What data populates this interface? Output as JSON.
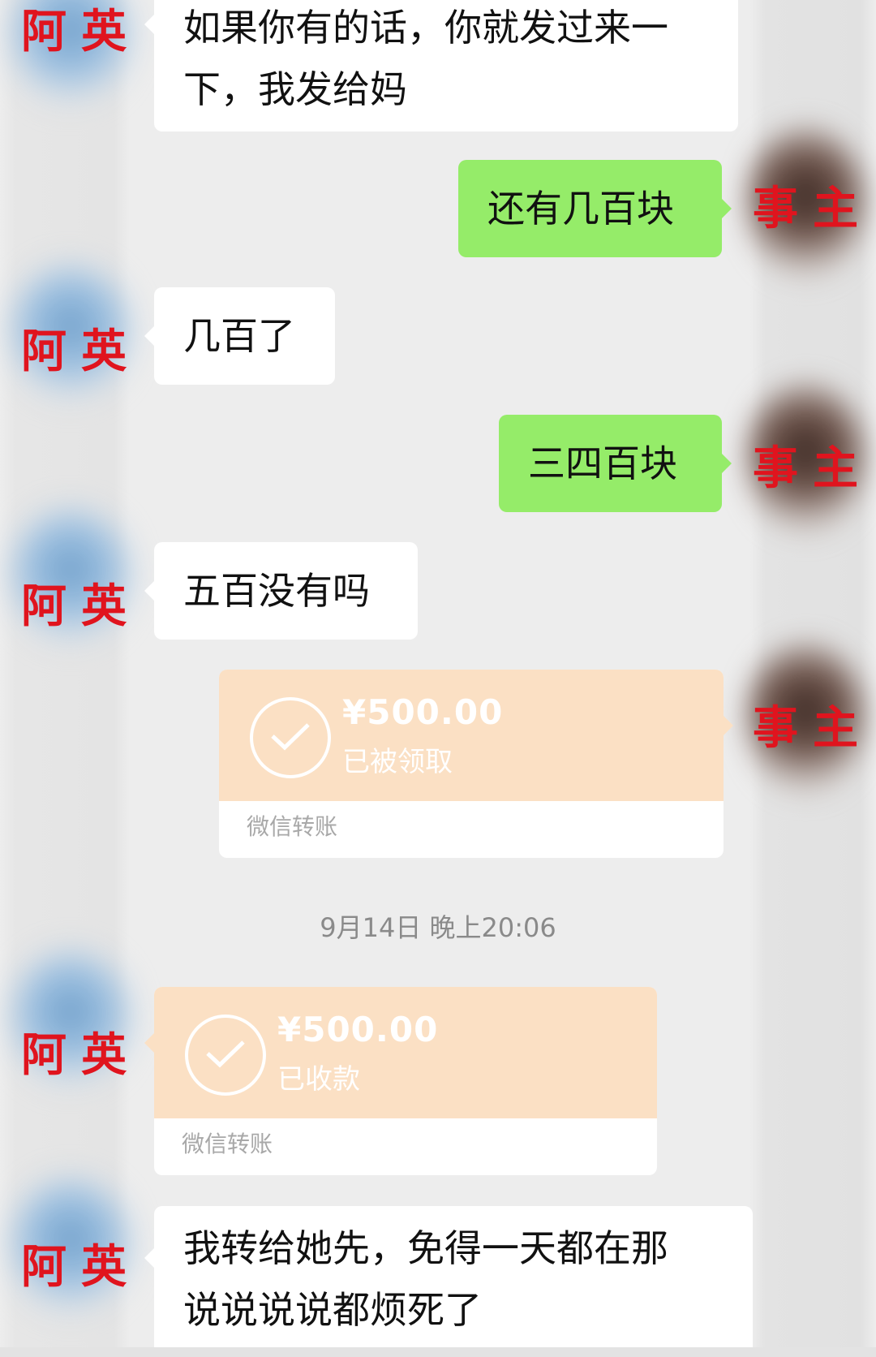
{
  "labels": {
    "other": "阿英",
    "self": "事主"
  },
  "messages": [
    {
      "side": "left",
      "text": [
        "如果你有的话，你就发过来一",
        "下，我发给妈"
      ]
    },
    {
      "side": "right",
      "text": "还有几百块"
    },
    {
      "side": "left",
      "text": "几百了"
    },
    {
      "side": "right",
      "text": "三四百块"
    },
    {
      "side": "left",
      "text": "五百没有吗"
    }
  ],
  "transfer_sent": {
    "amount": "¥500.00",
    "status": "已被领取",
    "footer": "微信转账"
  },
  "timestamp": "9月14日 晚上20:06",
  "transfer_received": {
    "amount": "¥500.00",
    "status": "已收款",
    "footer": "微信转账"
  },
  "last_message": {
    "side": "left",
    "text": [
      "我转给她先，免得一天都在那",
      "说说说说都烦死了"
    ]
  },
  "colors": {
    "self_bubble": "#95ec69",
    "other_bubble": "#ffffff",
    "transfer": "#fbe0c4",
    "label": "#e0141e",
    "background": "#ededed"
  },
  "icons": [
    "check-circle-icon"
  ]
}
